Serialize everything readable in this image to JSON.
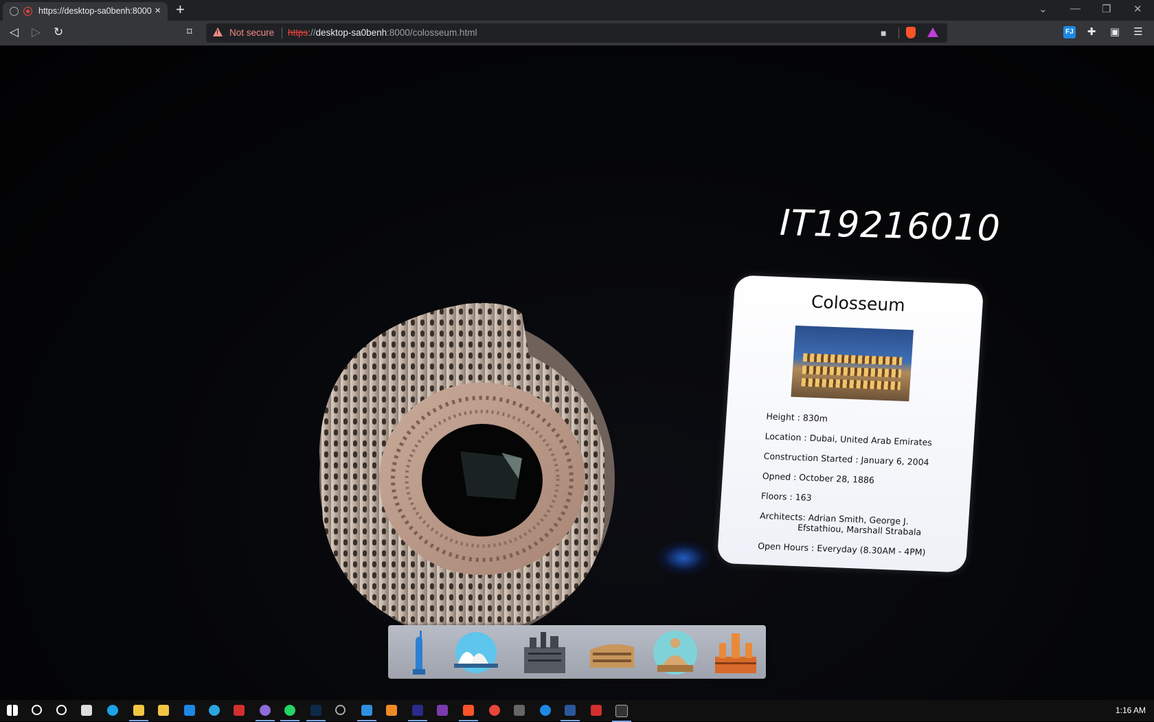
{
  "browser": {
    "tab_title": "https://desktop-sa0benh:8000",
    "new_tab_glyph": "+",
    "close_glyph": "×",
    "security_label": "Not secure",
    "url_scheme": "https",
    "url_sep": "://",
    "url_host": "desktop-sa0benh",
    "url_rest": ":8000/colosseum.html"
  },
  "scene": {
    "student_id": "IT19216010"
  },
  "card": {
    "title": "Colosseum",
    "height": "Height  : 830m",
    "location": "Location : Dubai, United Arab Emirates",
    "construction": "Construction Started : January 6, 2004",
    "opened": "Opned : October 28, 1886",
    "floors": "Floors : 163",
    "architects_1": "Architects: Adrian Smith, George J.",
    "architects_2": "Efstathiou, Marshall Strabala",
    "open_hours": "Open Hours : Everyday (8.30AM - 4PM)"
  },
  "dock": {
    "items": [
      "statue-of-liberty-icon",
      "sydney-opera-house-icon",
      "castle-icon",
      "colosseum-icon",
      "buddha-statue-icon",
      "temple-icon"
    ]
  },
  "taskbar": {
    "time": "1:16 AM"
  },
  "colors": {
    "accent_blue": "#1e88e5",
    "warning_red": "#f28b82",
    "card_bg": "#ffffff"
  }
}
